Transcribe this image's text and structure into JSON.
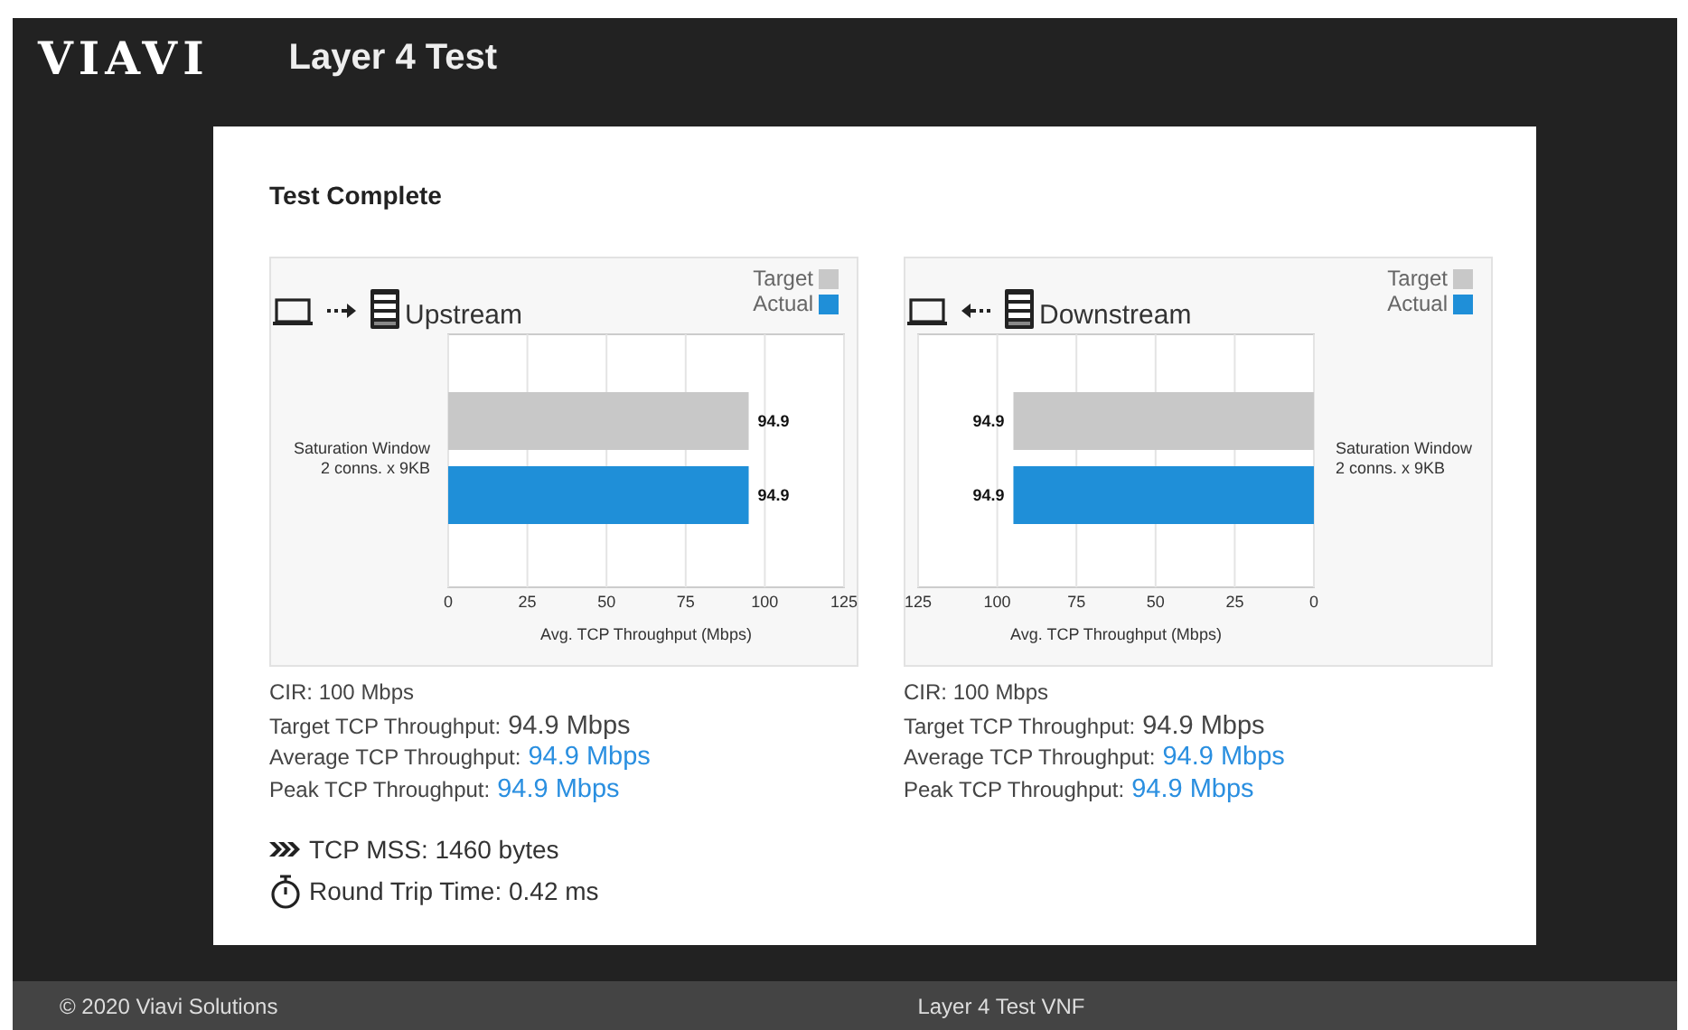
{
  "header": {
    "logo": "VIAVI",
    "title": "Layer 4 Test"
  },
  "card": {
    "heading": "Test Complete",
    "panels": [
      {
        "kind": "upstream",
        "title": "Upstream",
        "chart_data": {
          "type": "bar",
          "orientation": "horizontal",
          "xlabel": "Avg. TCP Throughput (Mbps)",
          "categories": [
            "Saturation Window\n2 conns. x 9KB"
          ],
          "series": [
            {
              "name": "Target",
              "color": "#c8c8c8",
              "values": [
                94.9
              ]
            },
            {
              "name": "Actual",
              "color": "#1f8fd8",
              "values": [
                94.9
              ]
            }
          ],
          "xlim": [
            0,
            125
          ],
          "xticks": [
            0,
            25,
            50,
            75,
            100,
            125
          ],
          "grid": true,
          "data_labels": true
        },
        "stats": [
          {
            "kind": "plain",
            "label": "CIR: 100 Mbps"
          },
          {
            "kind": "large",
            "label": "Target TCP Throughput:",
            "value": "94.9 Mbps"
          },
          {
            "kind": "accent",
            "label": "Average TCP Throughput:",
            "value": "94.9 Mbps"
          },
          {
            "kind": "accent",
            "label": "Peak TCP Throughput:",
            "value": "94.9 Mbps"
          }
        ]
      },
      {
        "kind": "downstream",
        "title": "Downstream",
        "chart_data": {
          "type": "bar",
          "orientation": "horizontal",
          "xlabel": "Avg. TCP Throughput (Mbps)",
          "categories": [
            "Saturation Window\n2 conns. x 9KB"
          ],
          "series": [
            {
              "name": "Target",
              "color": "#c8c8c8",
              "values": [
                94.9
              ]
            },
            {
              "name": "Actual",
              "color": "#1f8fd8",
              "values": [
                94.9
              ]
            }
          ],
          "xlim": [
            125,
            0
          ],
          "xticks": [
            125,
            100,
            75,
            50,
            25,
            0
          ],
          "grid": true,
          "data_labels": true
        },
        "stats": [
          {
            "kind": "plain",
            "label": "CIR: 100 Mbps"
          },
          {
            "kind": "large",
            "label": "Target TCP Throughput:",
            "value": "94.9 Mbps"
          },
          {
            "kind": "accent",
            "label": "Average TCP Throughput:",
            "value": "94.9 Mbps"
          },
          {
            "kind": "accent",
            "label": "Peak TCP Throughput:",
            "value": "94.9 Mbps"
          }
        ]
      }
    ],
    "extras": [
      {
        "kind": "mss",
        "text": "TCP MSS: 1460 bytes"
      },
      {
        "kind": "rtt",
        "text": "Round Trip Time: 0.42 ms"
      }
    ]
  },
  "footer": {
    "left": "© 2020 Viavi Solutions",
    "center": "Layer 4 Test VNF"
  }
}
